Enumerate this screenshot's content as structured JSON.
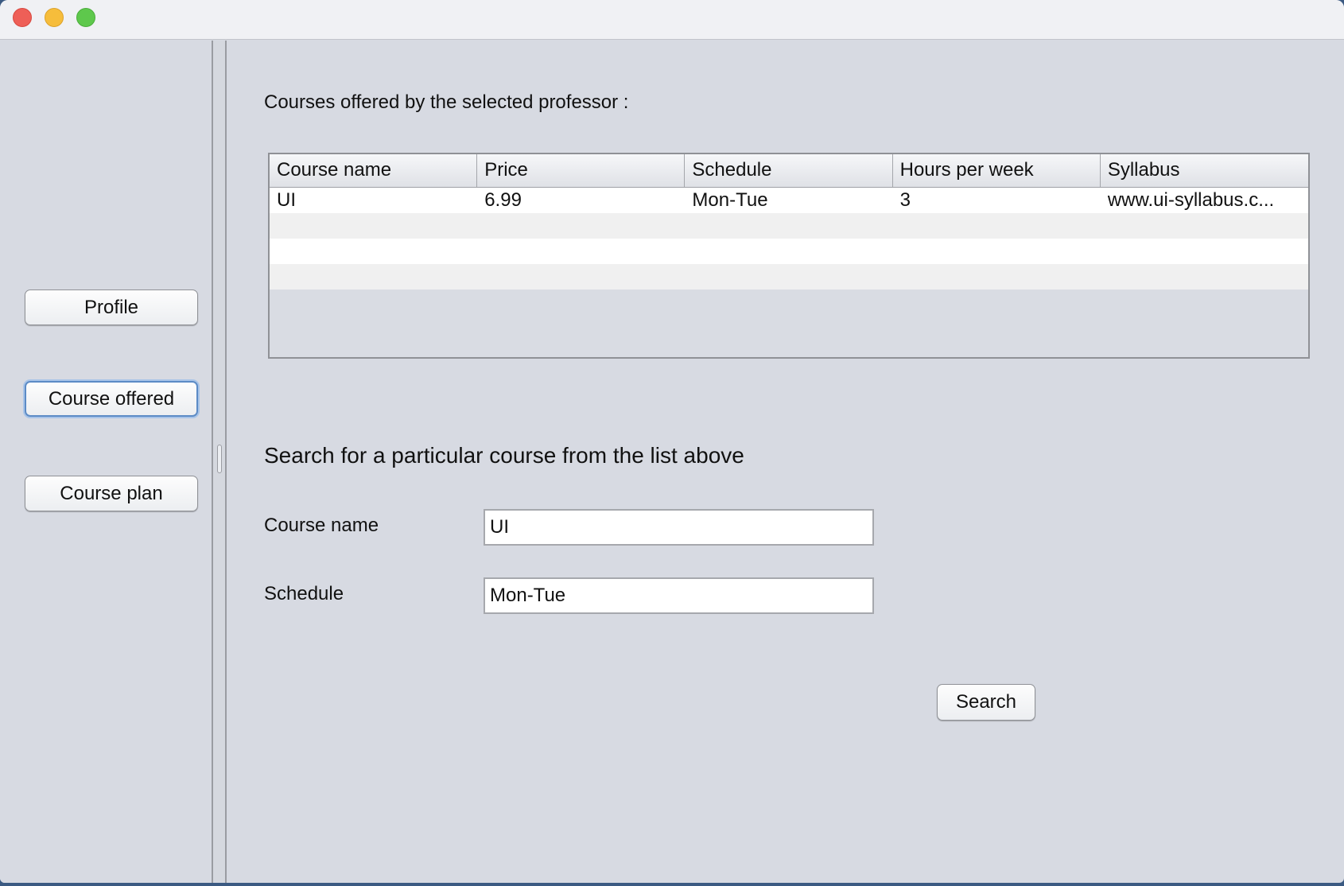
{
  "sidebar": {
    "items": [
      {
        "label": "Profile"
      },
      {
        "label": "Course offered"
      },
      {
        "label": "Course plan"
      }
    ]
  },
  "main": {
    "heading": "Courses offered by the selected professor :",
    "table": {
      "columns": [
        "Course name",
        "Price",
        "Schedule",
        "Hours per week",
        "Syllabus"
      ],
      "rows": [
        [
          "UI",
          "6.99",
          "Mon-Tue",
          "3",
          "www.ui-syllabus.c..."
        ]
      ]
    },
    "search": {
      "title": "Search for a particular course from the list above",
      "course_name_label": "Course name",
      "course_name_value": "UI",
      "schedule_label": "Schedule",
      "schedule_value": "Mon-Tue",
      "button_label": "Search"
    }
  }
}
